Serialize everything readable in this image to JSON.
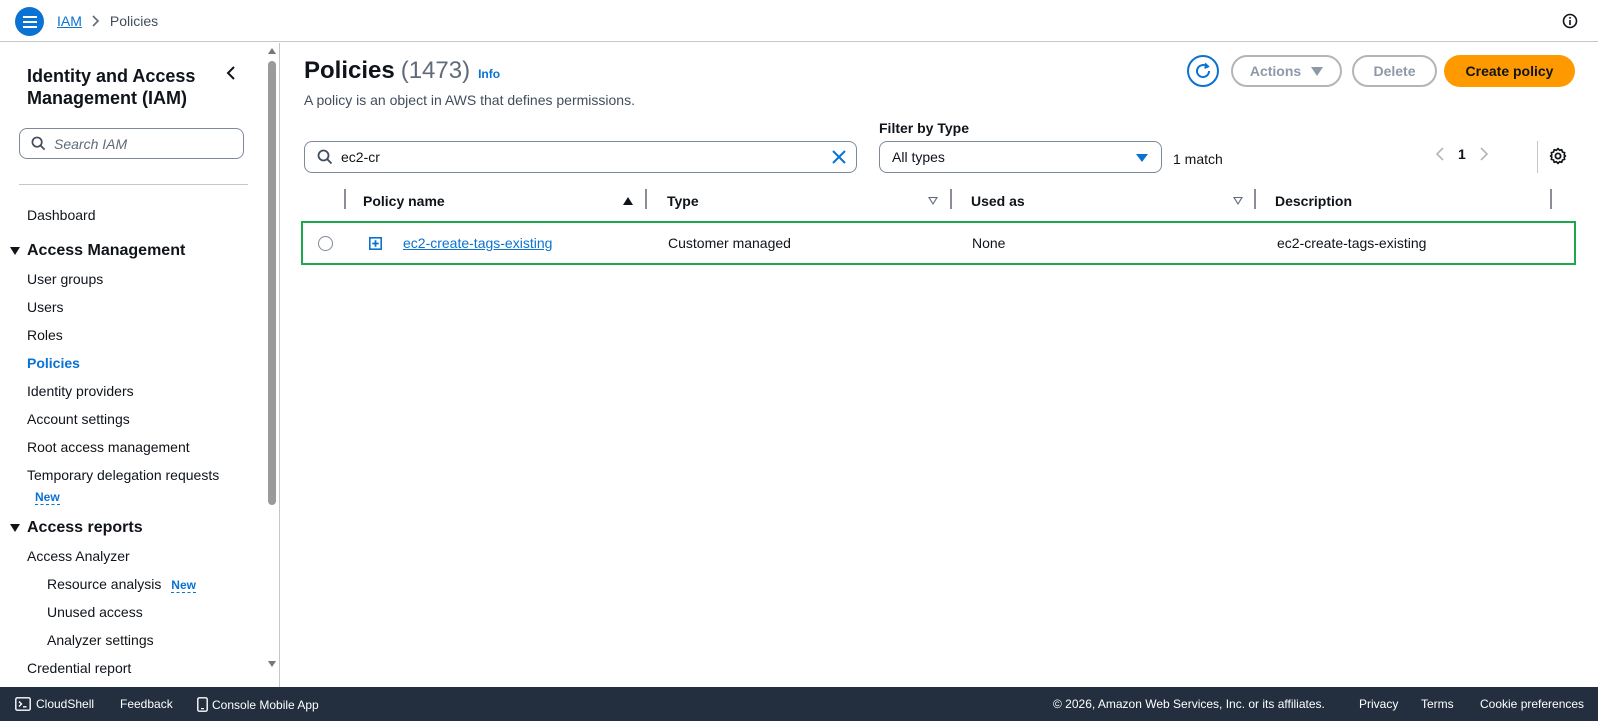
{
  "colors": {
    "accent": "#0972d3",
    "primary_button": "#ff9900",
    "footer_bg": "#232f3e",
    "row_highlight": "#1ea84b"
  },
  "topbar": {
    "breadcrumb": [
      "IAM",
      "Policies"
    ]
  },
  "sidebar": {
    "title": "Identity and Access Management (IAM)",
    "search_placeholder": "Search IAM",
    "dashboard": "Dashboard",
    "access_management": {
      "label": "Access Management",
      "items": [
        "User groups",
        "Users",
        "Roles",
        "Policies",
        "Identity providers",
        "Account settings",
        "Root access management",
        "Temporary delegation requests"
      ],
      "new_badge": "New"
    },
    "access_reports": {
      "label": "Access reports",
      "analyzer": "Access Analyzer",
      "sub_items": [
        "Resource analysis",
        "Unused access",
        "Analyzer settings"
      ],
      "new_badge": "New",
      "credential_report": "Credential report"
    }
  },
  "main": {
    "title": "Policies",
    "count": "(1473)",
    "info": "Info",
    "description": "A policy is an object in AWS that defines permissions.",
    "buttons": {
      "actions": "Actions",
      "delete": "Delete",
      "create": "Create policy"
    },
    "search": {
      "value": "ec2-cr"
    },
    "filter": {
      "label": "Filter by Type",
      "selected": "All types"
    },
    "match_count": "1 match",
    "page": "1",
    "table": {
      "columns": [
        "Policy name",
        "Type",
        "Used as",
        "Description"
      ],
      "rows": [
        {
          "name": "ec2-create-tags-existing",
          "type": "Customer managed",
          "used_as": "None",
          "description": "ec2-create-tags-existing"
        }
      ]
    }
  },
  "footer": {
    "cloudshell": "CloudShell",
    "feedback": "Feedback",
    "mobile_app": "Console Mobile App",
    "copyright": "© 2026, Amazon Web Services, Inc. or its affiliates.",
    "privacy": "Privacy",
    "terms": "Terms",
    "cookie": "Cookie preferences"
  }
}
